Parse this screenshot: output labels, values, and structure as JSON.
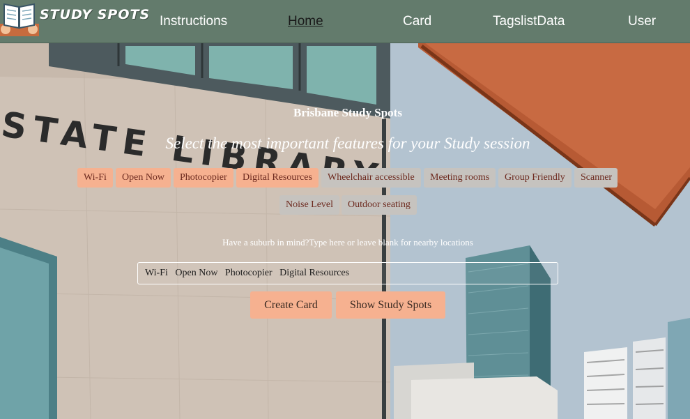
{
  "app": {
    "logo_text": "STUDY SPOTS"
  },
  "nav": {
    "items": [
      {
        "label": "Instructions"
      },
      {
        "label": "Home",
        "active": true
      },
      {
        "label": "Card"
      },
      {
        "label": "TagslistData"
      },
      {
        "label": "User"
      }
    ]
  },
  "hero": {
    "title": "Brisbane Study Spots",
    "subtitle": "Select the most important features for your Study session"
  },
  "features": [
    {
      "label": "Wi-Fi",
      "selected": true
    },
    {
      "label": "Open Now",
      "selected": true
    },
    {
      "label": "Photocopier",
      "selected": true
    },
    {
      "label": "Digital Resources",
      "selected": true
    },
    {
      "label": "Wheelchair accessible",
      "selected": false
    },
    {
      "label": "Meeting rooms",
      "selected": false
    },
    {
      "label": "Group Friendly",
      "selected": false
    },
    {
      "label": "Scanner",
      "selected": false
    },
    {
      "label": "Noise Level",
      "selected": false
    },
    {
      "label": "Outdoor seating",
      "selected": false
    }
  ],
  "search": {
    "label": "Have a suburb in mind?Type here or leave blank for nearby locations",
    "value": "Wi-Fi   Open Now   Photocopier   Digital Resources"
  },
  "buttons": {
    "create_card": "Create Card",
    "show_spots": "Show Study Spots"
  },
  "background": {
    "signage": "STATE LIBRARY"
  },
  "colors": {
    "navbar": "#637b6c",
    "chip_selected": "#f6b190",
    "chip_unselected": "#c6c3bf",
    "chip_text": "#6d2a1f",
    "button": "#f6b190"
  },
  "icons": {
    "logo": "open-book-icon"
  }
}
